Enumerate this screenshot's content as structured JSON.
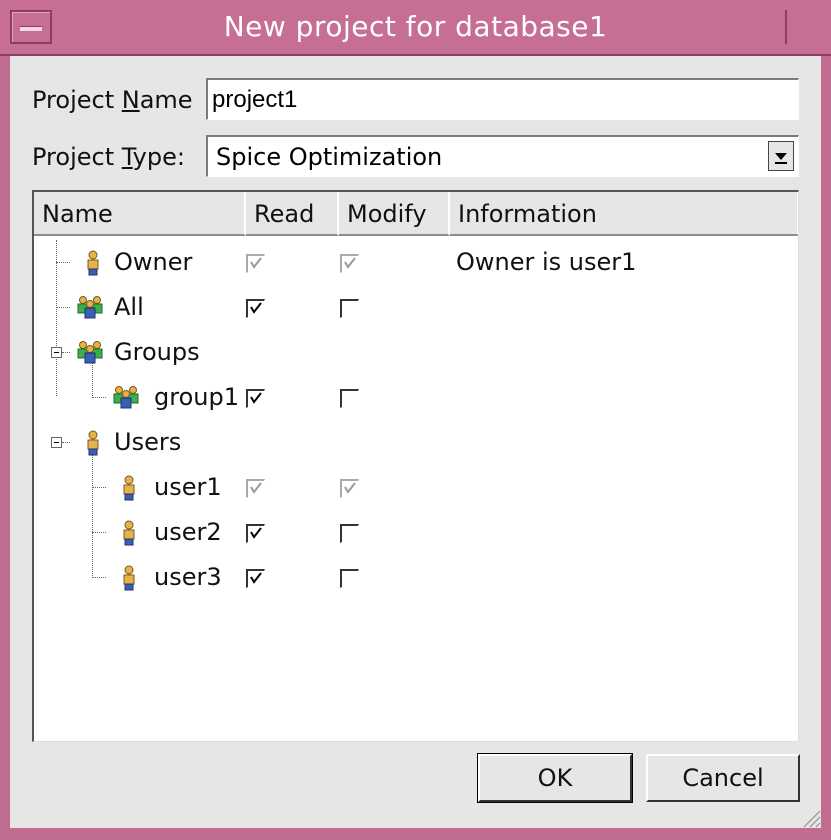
{
  "window": {
    "title": "New project for database1"
  },
  "form": {
    "name_label_pre": "Project ",
    "name_label_mnemonic": "N",
    "name_label_post": "ame",
    "name_value": "project1",
    "type_label_pre": "Project ",
    "type_label_mnemonic": "T",
    "type_label_post": "ype:",
    "type_value": "Spice Optimization"
  },
  "table": {
    "columns": [
      "Name",
      "Read",
      "Modify",
      "Information"
    ],
    "rows": [
      {
        "name": "Owner",
        "icon": "user-icon",
        "read": true,
        "read_enabled": false,
        "modify": true,
        "modify_enabled": false,
        "info": "Owner is user1"
      },
      {
        "name": "All",
        "icon": "group-icon",
        "read": true,
        "read_enabled": true,
        "modify": false,
        "modify_enabled": true,
        "info": ""
      },
      {
        "name": "Groups",
        "icon": "group-icon",
        "expanded": true
      },
      {
        "name": "group1",
        "icon": "group-icon",
        "read": true,
        "read_enabled": true,
        "modify": false,
        "modify_enabled": true,
        "info": ""
      },
      {
        "name": "Users",
        "icon": "user-icon",
        "expanded": true
      },
      {
        "name": "user1",
        "icon": "user-icon",
        "read": true,
        "read_enabled": false,
        "modify": true,
        "modify_enabled": false,
        "info": ""
      },
      {
        "name": "user2",
        "icon": "user-icon",
        "read": true,
        "read_enabled": true,
        "modify": false,
        "modify_enabled": true,
        "info": ""
      },
      {
        "name": "user3",
        "icon": "user-icon",
        "read": true,
        "read_enabled": true,
        "modify": false,
        "modify_enabled": true,
        "info": ""
      }
    ]
  },
  "buttons": {
    "ok": "OK",
    "cancel": "Cancel"
  }
}
